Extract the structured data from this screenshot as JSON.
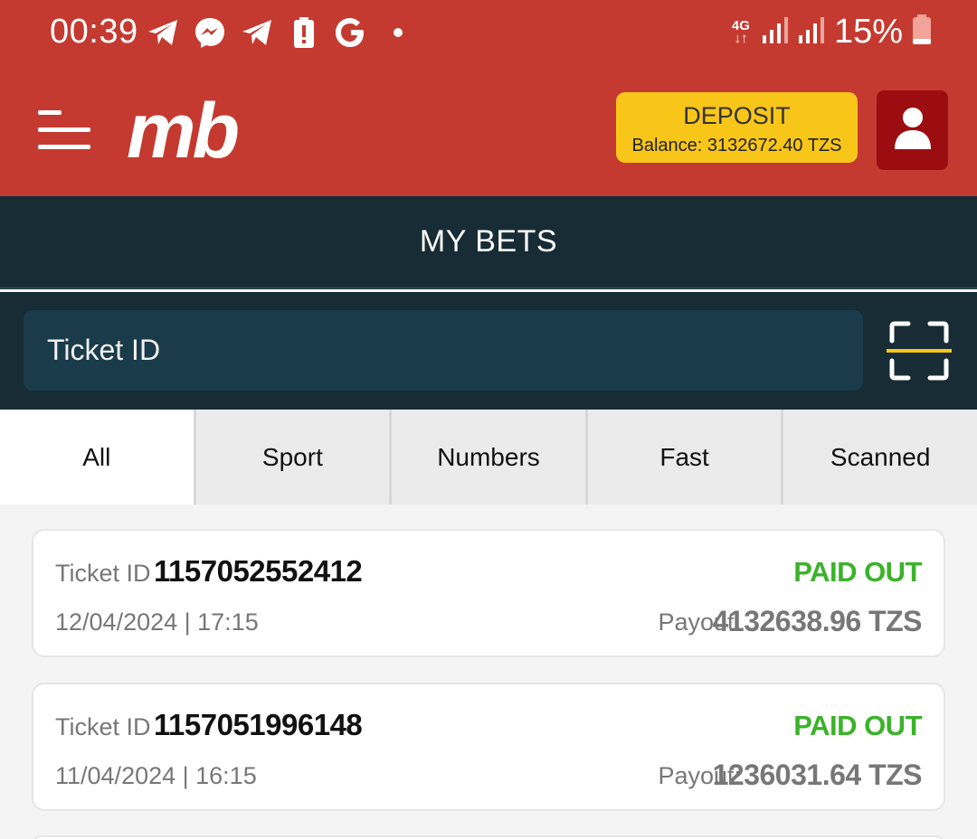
{
  "status_bar": {
    "time": "00:39",
    "network": "4G",
    "battery_percent": "15%",
    "icons": [
      "telegram-icon",
      "messenger-icon",
      "telegram-icon",
      "battery-alert-icon",
      "google-icon",
      "notification-dot-icon"
    ]
  },
  "header": {
    "logo": "mb",
    "deposit_label": "DEPOSIT",
    "balance": "Balance: 3132672.40 TZS"
  },
  "page": {
    "title": "MY BETS"
  },
  "search": {
    "placeholder": "Ticket ID"
  },
  "tabs": [
    {
      "label": "All",
      "active": true
    },
    {
      "label": "Sport",
      "active": false
    },
    {
      "label": "Numbers",
      "active": false
    },
    {
      "label": "Fast",
      "active": false
    },
    {
      "label": "Scanned",
      "active": false
    }
  ],
  "tickets": [
    {
      "id_label": "Ticket ID",
      "id": "1157052552412",
      "date": "12/04/2024 | 17:15",
      "status": "PAID OUT",
      "payout_label": "Payout:",
      "payout": "4132638.96 TZS"
    },
    {
      "id_label": "Ticket ID",
      "id": "1157051996148",
      "date": "11/04/2024 | 16:15",
      "status": "PAID OUT",
      "payout_label": "Payout:",
      "payout": "1236031.64 TZS"
    }
  ],
  "colors": {
    "brand_red": "#c53a30",
    "deposit_yellow": "#f8c619",
    "user_button": "#9c0d12",
    "dark_navy": "#172c35",
    "paid_green": "#3bb22a"
  }
}
